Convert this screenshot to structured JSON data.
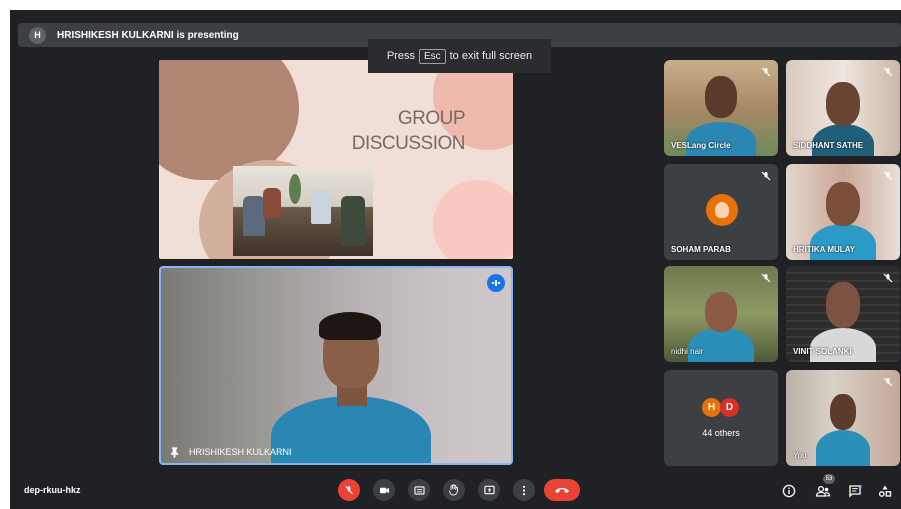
{
  "banner": {
    "avatar_initial": "H",
    "text": "HRISHIKESH KULKARNI is presenting"
  },
  "esc_tip": {
    "prefix": "Press",
    "key": "Esc",
    "suffix": "to exit full screen"
  },
  "slide": {
    "title_line1": "GROUP",
    "title_line2": "DISCUSSION"
  },
  "presenter": {
    "name": "HRISHIKESH KULKARNI"
  },
  "participants": [
    {
      "name": "VESLang Circle"
    },
    {
      "name": "SIDDHANT SATHE"
    },
    {
      "name": "SOHAM PARAB"
    },
    {
      "name": "HRITIKA MULAY"
    },
    {
      "name": "nidhi nair"
    },
    {
      "name": "VINIT SOLANKI"
    },
    {
      "name": "You"
    }
  ],
  "others": {
    "initials": [
      "H",
      "D"
    ],
    "label": "44 others"
  },
  "footer": {
    "meeting_code": "dep-rkuu-hkz",
    "participant_count": "53"
  },
  "colors": {
    "background": "#202124",
    "tile": "#3c4043",
    "accent": "#1a73e8",
    "end_call": "#ea4335"
  }
}
